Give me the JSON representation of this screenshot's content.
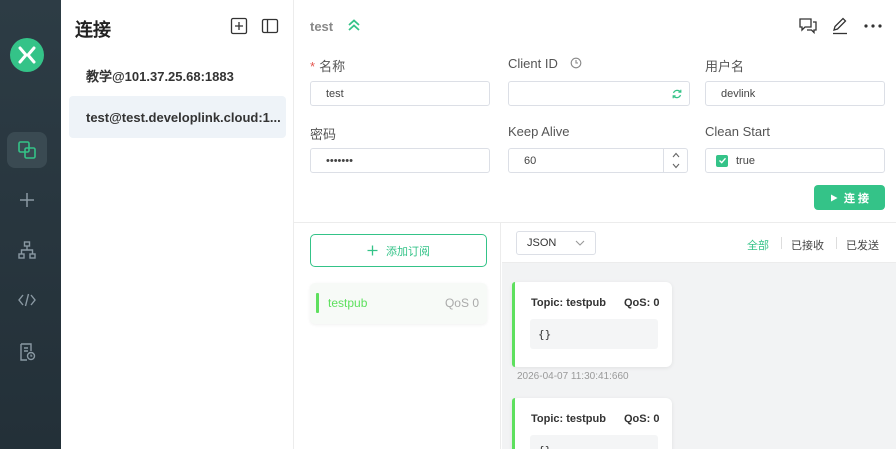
{
  "sidebar": {
    "title": "连接",
    "connections": [
      {
        "label": "教学@101.37.25.68:1883"
      },
      {
        "label": "test@test.developlink.cloud:1..."
      }
    ]
  },
  "header": {
    "title": "test"
  },
  "form": {
    "name_label": "名称",
    "name_required": "*",
    "name_value": "test",
    "client_id_label": "Client ID",
    "client_id_value": "",
    "username_label": "用户名",
    "username_value": "devlink",
    "password_label": "密码",
    "password_value": "•••••••",
    "keepalive_label": "Keep Alive",
    "keepalive_value": "60",
    "clean_start_label": "Clean Start",
    "clean_start_value": "true",
    "connect_label": "连 接"
  },
  "subscriptions": {
    "add_label": "添加订阅",
    "items": [
      {
        "topic": "testpub",
        "qos": "QoS 0"
      }
    ]
  },
  "messages": {
    "format": "JSON",
    "filters": {
      "all": "全部",
      "received": "已接收",
      "published": "已发送"
    },
    "items": [
      {
        "topic": "Topic: testpub",
        "qos": "QoS: 0",
        "payload": "{}",
        "time": "2026-04-07 11:30:41:660"
      },
      {
        "topic": "Topic: testpub",
        "qos": "QoS: 0",
        "payload": "{}",
        "time": ""
      }
    ]
  },
  "colors": {
    "accent": "#34c388",
    "rail": "#2d3c45",
    "topic_green": "#5ee05e"
  }
}
